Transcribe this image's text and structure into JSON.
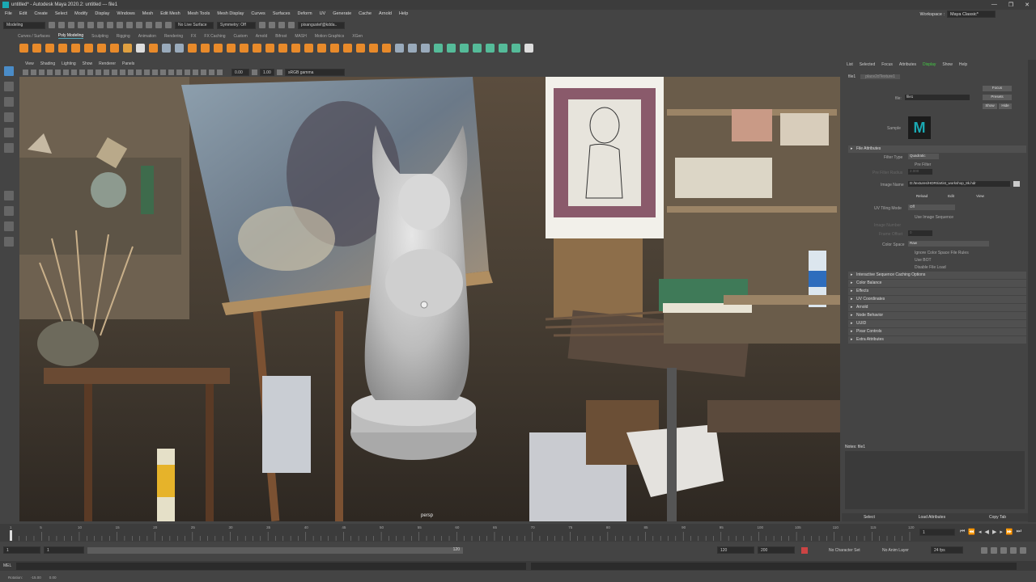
{
  "window": {
    "title": "untitled* - Autodesk Maya 2020.2: untitled  ---  file1",
    "controls": [
      "—",
      "❐",
      "✕"
    ]
  },
  "menubar": {
    "items": [
      "File",
      "Edit",
      "Create",
      "Select",
      "Modify",
      "Display",
      "Windows",
      "Mesh",
      "Edit Mesh",
      "Mesh Tools",
      "Mesh Display",
      "Curves",
      "Surfaces",
      "Deform",
      "UV",
      "Generate",
      "Cache",
      "Arnold",
      "Help"
    ],
    "workspace_label": "Workspace :",
    "workspace_value": "Maya Classic*"
  },
  "statusline": {
    "mode": "Modeling",
    "live_surface": "No Live Surface",
    "symmetry": "Symmetry: Off",
    "user": "pixangustef@kdda.."
  },
  "shelf": {
    "tabs": [
      "Curves / Surfaces",
      "Poly Modeling",
      "Sculpting",
      "Rigging",
      "Animation",
      "Rendering",
      "FX",
      "FX Caching",
      "Custom",
      "Arnold",
      "Bifrost",
      "MASH",
      "Motion Graphics",
      "XGen"
    ],
    "active": "Poly Modeling"
  },
  "panel": {
    "menus": [
      "View",
      "Shading",
      "Lighting",
      "Show",
      "Renderer",
      "Panels"
    ],
    "exposure": "0.00",
    "gamma": "1.00",
    "colorspace": "sRGB gamma",
    "camera": "persp"
  },
  "attribute_editor": {
    "menus": [
      "List",
      "Selected",
      "Focus",
      "Attributes",
      "Display",
      "Show",
      "Help"
    ],
    "active_menu": "Display",
    "tabs": [
      "file1",
      "place2dTexture1"
    ],
    "node_label": "file:",
    "node_value": "file1",
    "buttons": [
      "Focus",
      "Presets",
      "Show",
      "Hide"
    ],
    "sample_label": "Sample",
    "sections": {
      "file_attributes": "File Attributes",
      "filter_type_label": "Filter Type",
      "filter_type_value": "Quadratic",
      "pre_filter": "Pre Filter",
      "pre_filter_radius": "Pre Filter Radius",
      "pre_filter_radius_value": "2.000",
      "image_name_label": "Image Name",
      "image_name_value": "D:/textures/HDRI/artist_workshop_8k.hdr",
      "reload": "Reload",
      "edit": "Edit",
      "view": "View",
      "uv_tiling_label": "UV Tiling Mode",
      "uv_tiling_value": "Off",
      "use_image_sequence": "Use Image Sequence",
      "image_number": "Image Number",
      "frame_offset": "Frame Offset",
      "frame_offset_value": "0",
      "color_space_label": "Color Space",
      "color_space_value": "Raw",
      "ignore_cs_rules": "Ignore Color Space File Rules",
      "use_bot": "Use BOT",
      "disable_file_load": "Disable File Load"
    },
    "collapsed": [
      "Interactive Sequence Caching Options",
      "Color Balance",
      "Effects",
      "UV Coordinates",
      "Arnold",
      "Node Behavior",
      "UUID",
      "Pixar Controls",
      "Extra Attributes"
    ],
    "notes_label": "Notes: file1",
    "footer": [
      "Select",
      "Load Attributes",
      "Copy Tab"
    ]
  },
  "timeline": {
    "ticks": [
      "1",
      "5",
      "10",
      "15",
      "20",
      "25",
      "30",
      "35",
      "40",
      "45",
      "50",
      "55",
      "60",
      "65",
      "70",
      "75",
      "80",
      "85",
      "90",
      "95",
      "100",
      "105",
      "110",
      "115",
      "120"
    ],
    "current": "1"
  },
  "range": {
    "start": "1",
    "start2": "1",
    "end_inner": "120",
    "end": "120",
    "end2": "200",
    "char_set": "No Character Set",
    "anim_layer": "No Anim Layer",
    "fps": "24 fps"
  },
  "cmdline": {
    "lang": "MEL"
  },
  "helpline": {
    "rotation_label": "Rotation:",
    "rotation_x": "-15.00",
    "rotation_y": "0.00"
  },
  "colors": {
    "accent": "#1aa9b3",
    "bg": "#444444",
    "field": "#2b2b2b",
    "green": "#44cc44"
  }
}
